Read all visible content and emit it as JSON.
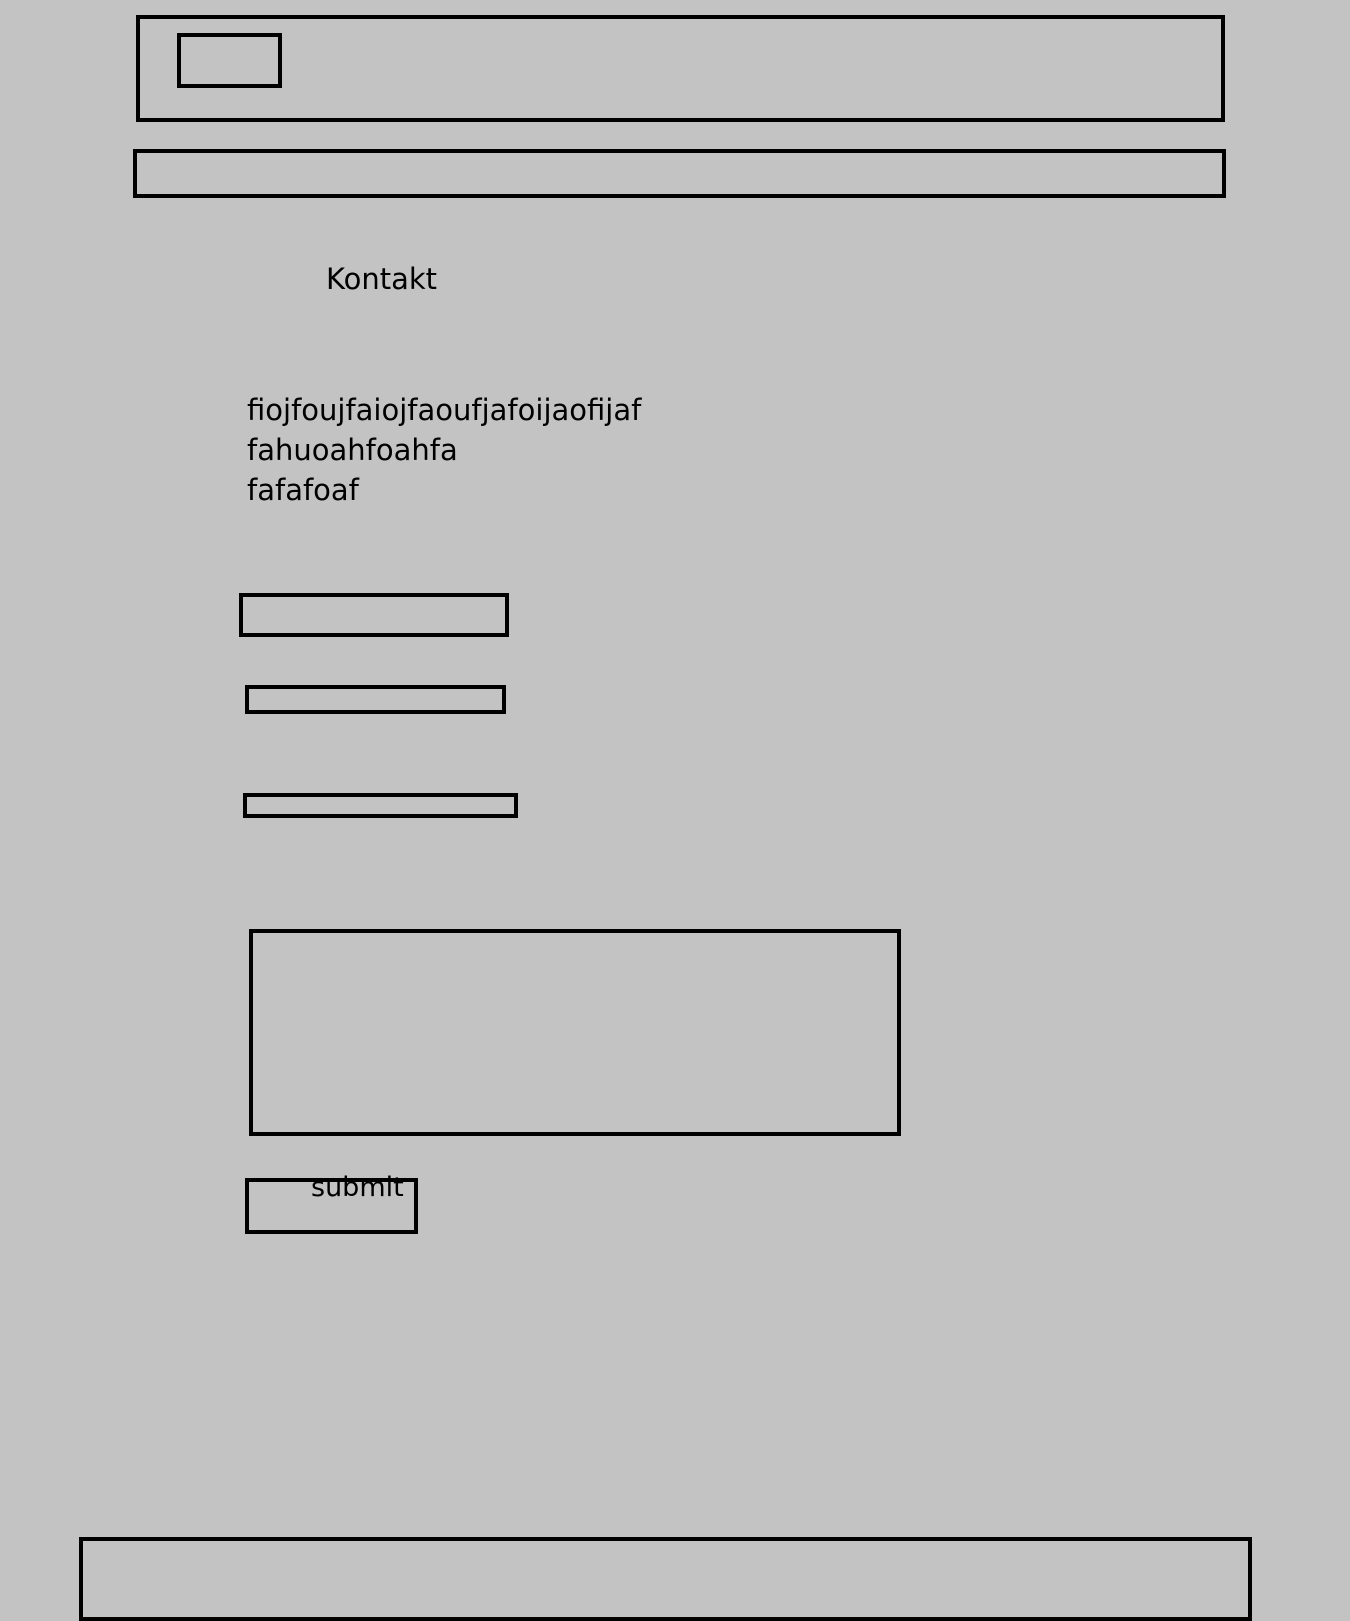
{
  "page": {
    "background": "#c3c3c3",
    "title": "Kontakt"
  },
  "intro": {
    "lines": [
      "fiojfoujfaiojfaoufjafoijaofijaf",
      "fahuoahfoahfa",
      "fafafoaf"
    ]
  },
  "form": {
    "submit_label": "submit"
  }
}
